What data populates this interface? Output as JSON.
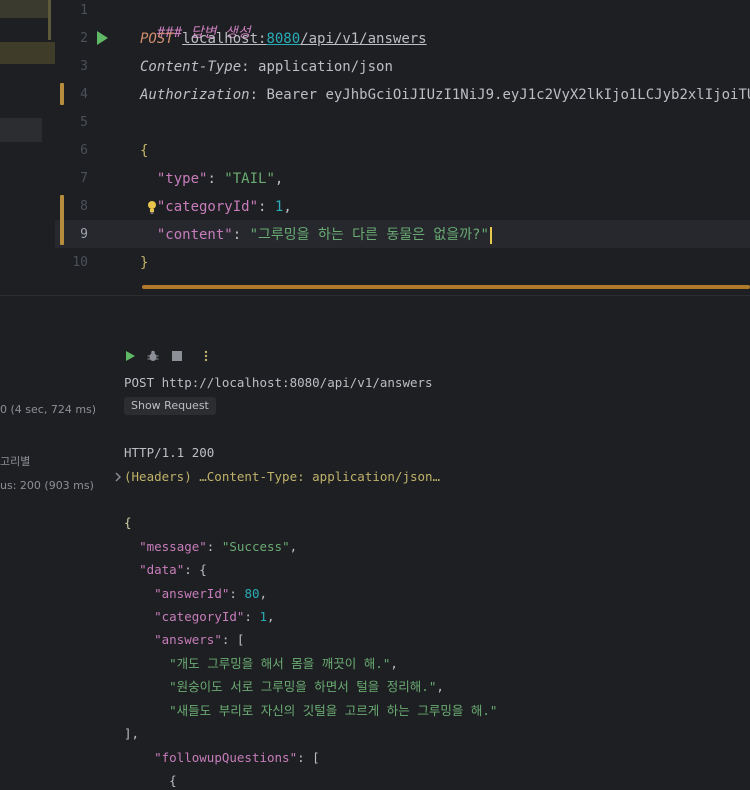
{
  "editor": {
    "line_numbers": [
      "1",
      "2",
      "3",
      "4",
      "5",
      "6",
      "7",
      "8",
      "9",
      "10"
    ],
    "comment": "### 답변 생성",
    "method": "POST",
    "url_host": "localhost:",
    "url_port": "8080",
    "url_path": "/api/v1/answers",
    "header1_name": "Content-Type",
    "header1_value": " application/json",
    "header2_name": "Authorization",
    "header2_value": " Bearer eyJhbGciOiJIUzI1NiJ9.eyJ1c2VyX2lkIjo1LCJyb2xlIjoiTU",
    "open_brace": "{",
    "close_brace": "}",
    "body": [
      {
        "key": "\"type\"",
        "sep": ": ",
        "value": "\"TAIL\"",
        "value_kind": "str",
        "trail": ","
      },
      {
        "key": "\"categoryId\"",
        "sep": ": ",
        "value": "1",
        "value_kind": "num",
        "trail": ","
      },
      {
        "key": "\"content\"",
        "sep": ": ",
        "value": "\"그루밍을 하는 다른 동물은 없을까?",
        "value_kind": "str",
        "trail": "\""
      }
    ]
  },
  "services": {
    "duration_text": "0 (4 sec, 724 ms)",
    "category_text": "고리별",
    "status_text": "us: 200 (903 ms)"
  },
  "toolbar": {
    "run": "run-icon",
    "debug": "debug-icon",
    "stop": "stop-icon",
    "more": "more-icon"
  },
  "output": {
    "request_line": "POST http://localhost:8080/api/v1/answers",
    "show_request": "Show Request",
    "status_line": "HTTP/1.1 200",
    "headers_line": "(Headers) …Content-Type: application/json…",
    "json_open": "{",
    "message_key": "\"message\"",
    "message_value": "\"Success\"",
    "data_key": "\"data\"",
    "answer_id_key": "\"answerId\"",
    "answer_id_value": "80",
    "category_id_key": "\"categoryId\"",
    "category_id_value": "1",
    "answers_key": "\"answers\"",
    "answers": [
      "\"개도 그루밍을 해서 몸을 깨끗이 해.\"",
      "\"원숭이도 서로 그루밍을 하면서 털을 정리해.\"",
      "\"새들도 부리로 자신의 깃털을 고르게 하는 그루밍을 해.\""
    ],
    "answers_close": "],",
    "followup_key": "\"followupQuestions\"",
    "followup_open_partial": "{"
  }
}
